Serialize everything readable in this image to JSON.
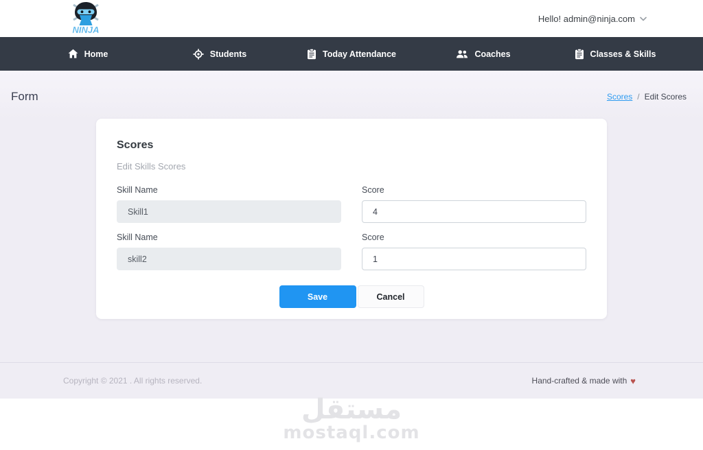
{
  "header": {
    "logo_name": "NINJA",
    "account_label": "Hello! admin@ninja.com"
  },
  "nav": {
    "items": [
      {
        "label": "Home",
        "icon": "home-icon"
      },
      {
        "label": "Students",
        "icon": "target-icon"
      },
      {
        "label": "Today Attendance",
        "icon": "clipboard-icon"
      },
      {
        "label": "Coaches",
        "icon": "people-icon"
      },
      {
        "label": "Classes & Skills",
        "icon": "clipboard-icon"
      }
    ]
  },
  "page": {
    "title": "Form",
    "breadcrumb": {
      "link": "Scores",
      "separator": "/",
      "current": "Edit Scores"
    }
  },
  "card": {
    "title": "Scores",
    "subtitle": "Edit Skills Scores",
    "fields": [
      {
        "label": "Skill Name",
        "value": "Skill1"
      },
      {
        "label": "Score",
        "value": "4"
      },
      {
        "label": "Skill Name",
        "value": "skill2"
      },
      {
        "label": "Score",
        "value": "1"
      }
    ],
    "save_label": "Save",
    "cancel_label": "Cancel"
  },
  "footer": {
    "copyright": "Copyright © 2021 . All rights reserved.",
    "credit": "Hand-crafted & made with",
    "heart": "♥"
  },
  "watermark": {
    "arabic": "مستقل",
    "latin": "mostaql.com"
  },
  "colors": {
    "accent": "#2095f2",
    "navbar": "#343b46",
    "link": "#2e9bf0",
    "heart": "#b9534f",
    "page_bg": "#efedf4"
  }
}
